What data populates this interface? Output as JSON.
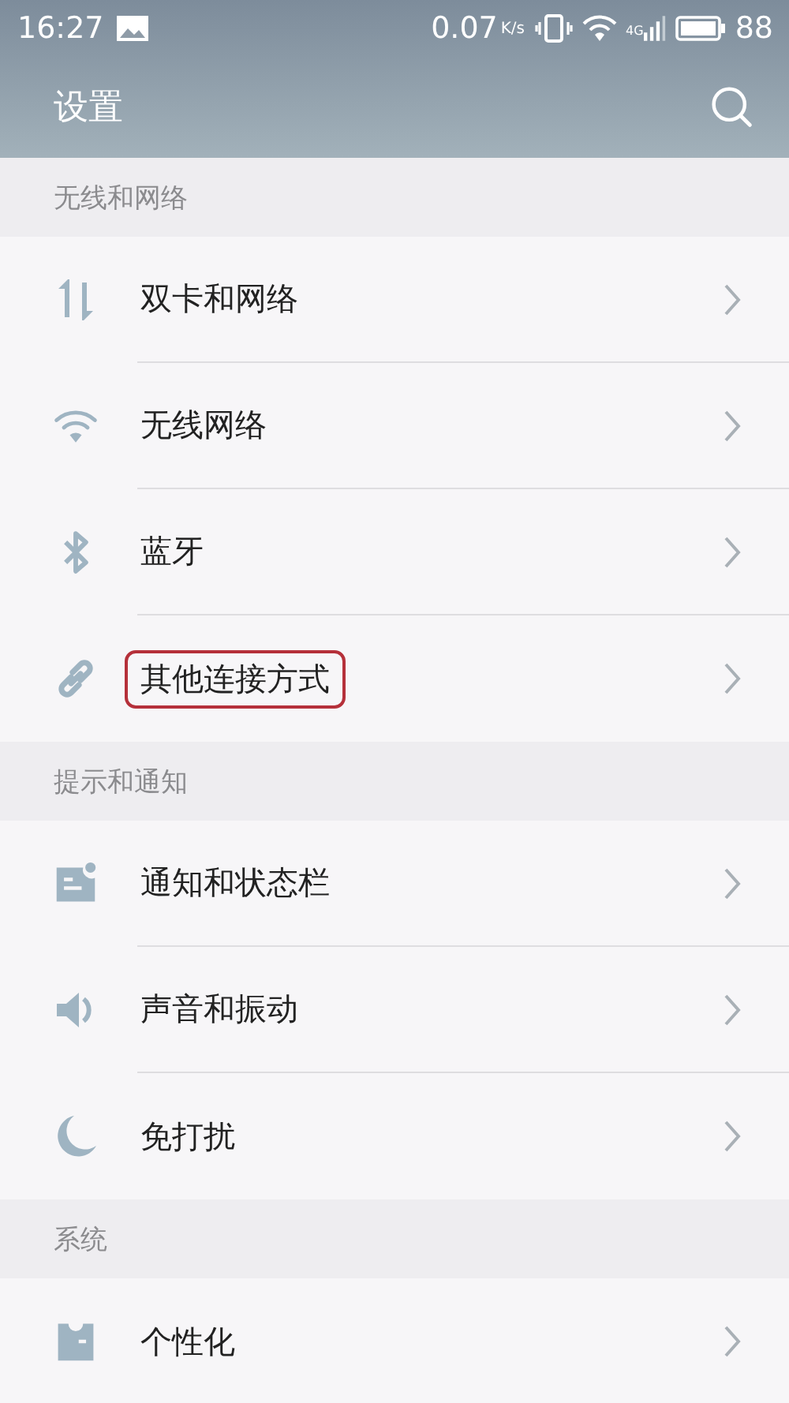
{
  "status_bar": {
    "time": "16:27",
    "speed": "0.07",
    "speed_unit": "K/s",
    "network": "4G",
    "battery": "88"
  },
  "header": {
    "title": "设置"
  },
  "sections": [
    {
      "title": "无线和网络",
      "items": [
        {
          "kind": "arrows",
          "label": "双卡和网络",
          "highlighted": false
        },
        {
          "kind": "wifi",
          "label": "无线网络",
          "highlighted": false
        },
        {
          "kind": "bluetooth",
          "label": "蓝牙",
          "highlighted": false
        },
        {
          "kind": "link",
          "label": "其他连接方式",
          "highlighted": true
        }
      ]
    },
    {
      "title": "提示和通知",
      "items": [
        {
          "kind": "notification",
          "label": "通知和状态栏",
          "highlighted": false
        },
        {
          "kind": "speaker",
          "label": "声音和振动",
          "highlighted": false
        },
        {
          "kind": "moon",
          "label": "免打扰",
          "highlighted": false
        }
      ]
    },
    {
      "title": "系统",
      "items": [
        {
          "kind": "shirt",
          "label": "个性化",
          "highlighted": false
        }
      ]
    }
  ]
}
